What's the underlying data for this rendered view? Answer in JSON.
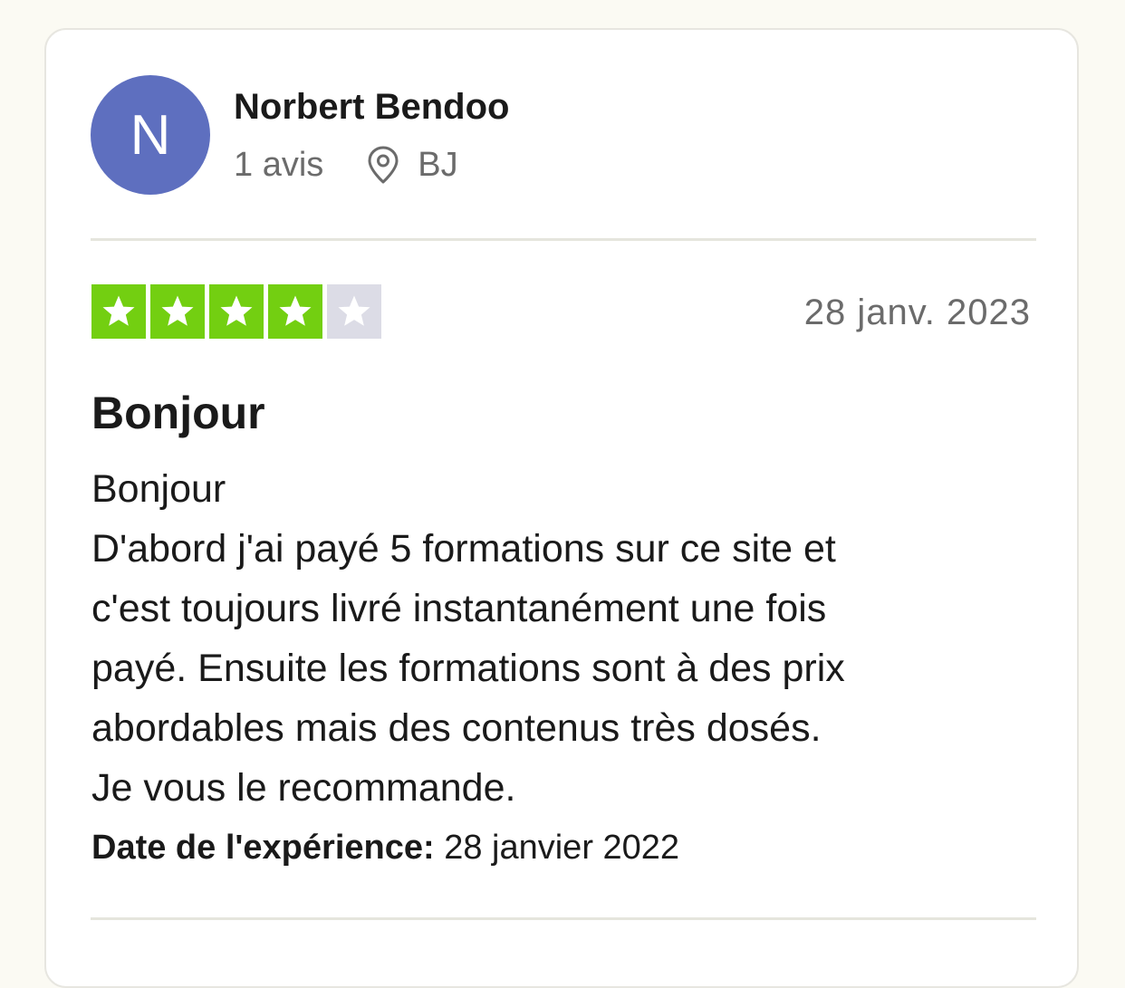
{
  "user": {
    "initial": "N",
    "name": "Norbert Bendoo",
    "reviews_count": "1 avis",
    "country": "BJ",
    "avatar_color": "#5e6fbf"
  },
  "review": {
    "rating": 4,
    "max_rating": 5,
    "date": "28 janv. 2023",
    "title": "Bonjour",
    "body_lines": [
      "Bonjour",
      "D'abord j'ai payé 5 formations sur ce site et",
      "c'est toujours livré instantanément une fois",
      "payé. Ensuite les formations sont à des prix",
      "abordables mais des contenus très dosés.",
      "Je vous le recommande."
    ],
    "experience_label": "Date de l'expérience:",
    "experience_date": "28 janvier 2022"
  },
  "colors": {
    "star_filled": "#73cf11",
    "star_empty": "#dcdce6"
  },
  "icons": {
    "location": "map-pin-icon",
    "star": "star-icon"
  }
}
